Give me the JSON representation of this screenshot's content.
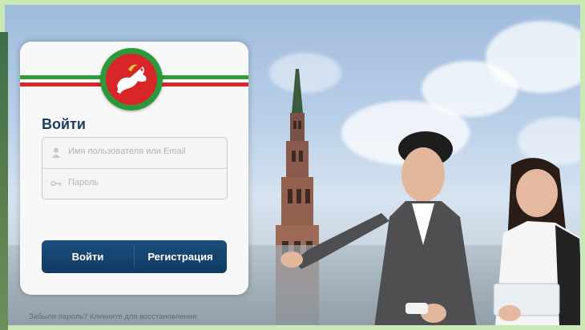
{
  "login_panel": {
    "title": "Войти",
    "username_placeholder": "Имя пользователя или Email",
    "password_placeholder": "Пароль",
    "login_button": "Войти",
    "register_button": "Регистрация"
  },
  "footer": {
    "forgot_text": "Забыли пароль? Кликните для восстановления"
  },
  "colors": {
    "flag_green": "#2f9f3e",
    "flag_red": "#d9262a",
    "button_blue": "#0f3a61",
    "title_blue": "#1d3c5d"
  }
}
